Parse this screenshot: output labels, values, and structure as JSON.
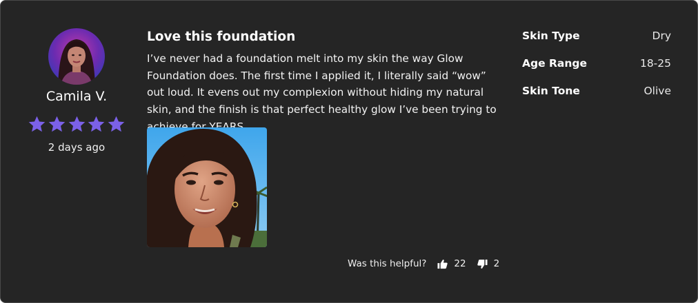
{
  "reviewer": {
    "name": "Camila V.",
    "rating": 5,
    "rating_max": 5,
    "date": "2 days ago"
  },
  "review": {
    "title": "Love this foundation",
    "body": "I’ve never had a foundation melt into my skin the way Glow Foundation does. The first time I applied it, I literally said “wow” out loud. It evens out my complexion without hiding my natural skin, and the finish is that perfect healthy glow I’ve been trying to achieve for YEARS."
  },
  "helpful": {
    "question": "Was this helpful?",
    "up_count": "22",
    "down_count": "2"
  },
  "attributes": [
    {
      "label": "Skin Type",
      "value": "Dry"
    },
    {
      "label": "Age Range",
      "value": "18-25"
    },
    {
      "label": "Skin Tone",
      "value": "Olive"
    }
  ],
  "colors": {
    "card_background": "#252525",
    "star": "#7B61E8",
    "text": "#ffffff"
  },
  "icons": {
    "rating": "star-icon",
    "helpful_up": "thumbs-up-icon",
    "helpful_down": "thumbs-down-icon"
  }
}
